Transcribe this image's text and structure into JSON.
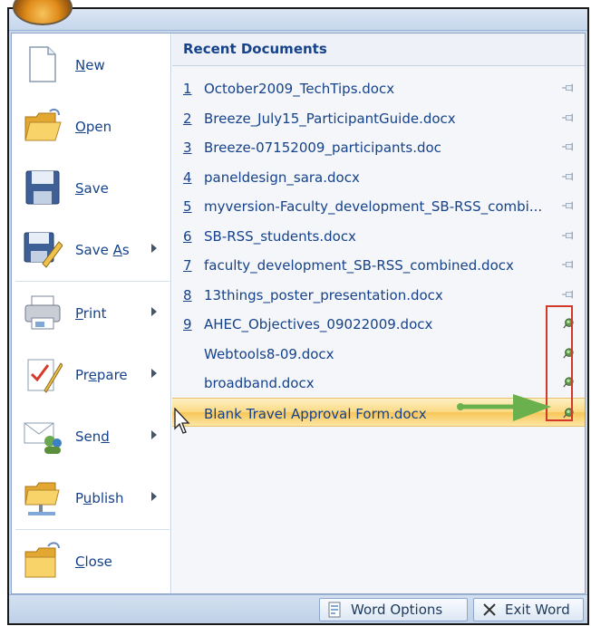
{
  "left_menu": {
    "items": [
      {
        "label": "New",
        "accel": "N",
        "icon": "new-document-icon",
        "has_submenu": false
      },
      {
        "label": "Open",
        "accel": "O",
        "icon": "open-folder-icon",
        "has_submenu": false
      },
      {
        "label": "Save",
        "accel": "S",
        "icon": "save-disk-icon",
        "has_submenu": false
      },
      {
        "label": "Save As",
        "accel": "A",
        "icon": "save-as-icon",
        "has_submenu": true
      },
      {
        "label": "Print",
        "accel": "P",
        "icon": "printer-icon",
        "has_submenu": true
      },
      {
        "label": "Prepare",
        "accel": "e",
        "icon": "prepare-icon",
        "has_submenu": true
      },
      {
        "label": "Send",
        "accel": "d",
        "icon": "send-icon",
        "has_submenu": true
      },
      {
        "label": "Publish",
        "accel": "u",
        "icon": "publish-icon",
        "has_submenu": true
      },
      {
        "label": "Close",
        "accel": "C",
        "icon": "close-folder-icon",
        "has_submenu": false
      }
    ]
  },
  "recent": {
    "header": "Recent Documents",
    "docs": [
      {
        "num": "1",
        "name": "October2009_TechTips.docx",
        "pinned": false
      },
      {
        "num": "2",
        "name": "Breeze_July15_ParticipantGuide.docx",
        "pinned": false
      },
      {
        "num": "3",
        "name": "Breeze-07152009_participants.doc",
        "pinned": false
      },
      {
        "num": "4",
        "name": "paneldesign_sara.docx",
        "pinned": false
      },
      {
        "num": "5",
        "name": "myversion-Faculty_development_SB-RSS_combi...",
        "pinned": false
      },
      {
        "num": "6",
        "name": "SB-RSS_students.docx",
        "pinned": false
      },
      {
        "num": "7",
        "name": "faculty_development_SB-RSS_combined.docx",
        "pinned": false
      },
      {
        "num": "8",
        "name": "13things_poster_presentation.docx",
        "pinned": false
      },
      {
        "num": "9",
        "name": "AHEC_Objectives_09022009.docx",
        "pinned": true
      },
      {
        "num": "",
        "name": "Webtools8-09.docx",
        "pinned": true
      },
      {
        "num": "",
        "name": "broadband.docx",
        "pinned": true
      },
      {
        "num": "",
        "name": "Blank Travel Approval Form.docx",
        "pinned": true,
        "highlighted": true
      }
    ]
  },
  "bottom": {
    "word_options": "Word Options",
    "exit_word": "Exit Word"
  },
  "colors": {
    "accent_text": "#15428b",
    "highlight": "#f8c659",
    "annotation_red": "#d2392a",
    "annotation_green": "#6ab04c"
  }
}
